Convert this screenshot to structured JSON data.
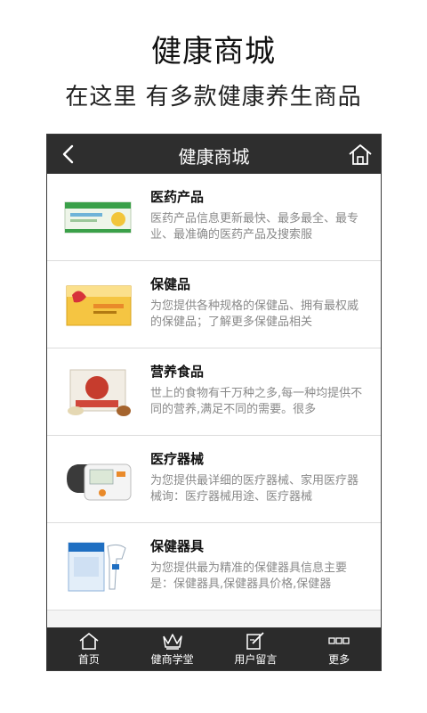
{
  "promo": {
    "title": "健康商城",
    "subtitle": "在这里 有多款健康养生商品"
  },
  "app": {
    "header_title": "健康商城",
    "back_icon": "chevron-left-icon",
    "home_icon": "home-icon"
  },
  "items": [
    {
      "name": "医药产品",
      "desc": "医药产品信息更新最快、最多最全、最专业、最准确的医药产品及搜索服",
      "thumb_colors": [
        "#e9f2e4",
        "#3aa049",
        "#f2c53a"
      ]
    },
    {
      "name": "保健品",
      "desc": "为您提供各种规格的保健品、拥有最权威的保健品；了解更多保健品相关",
      "thumb_colors": [
        "#f7e2a8",
        "#d7323a",
        "#f1b91c"
      ]
    },
    {
      "name": "营养食品",
      "desc": "世上的食物有千万种之多,每一种均提供不同的营养,满足不同的需要。很多",
      "thumb_colors": [
        "#e7e2d8",
        "#c63c2d",
        "#a5642e"
      ]
    },
    {
      "name": "医疗器械",
      "desc": "为您提供最详细的医疗器械、家用医疗器械询：医疗器械用途、医疗器械",
      "thumb_colors": [
        "#f1f1f1",
        "#555555",
        "#e98a2a"
      ]
    },
    {
      "name": "保健器具",
      "desc": "为您提供最为精准的保健器具信息主要是：保健器具,保健器具价格,保健器",
      "thumb_colors": [
        "#e3eef9",
        "#1f6fc2",
        "#ffffff"
      ]
    }
  ],
  "tabs": [
    {
      "label": "首页",
      "icon": "home-icon"
    },
    {
      "label": "健商学堂",
      "icon": "crown-icon"
    },
    {
      "label": "用户留言",
      "icon": "edit-note-icon"
    },
    {
      "label": "更多",
      "icon": "more-icon"
    }
  ]
}
